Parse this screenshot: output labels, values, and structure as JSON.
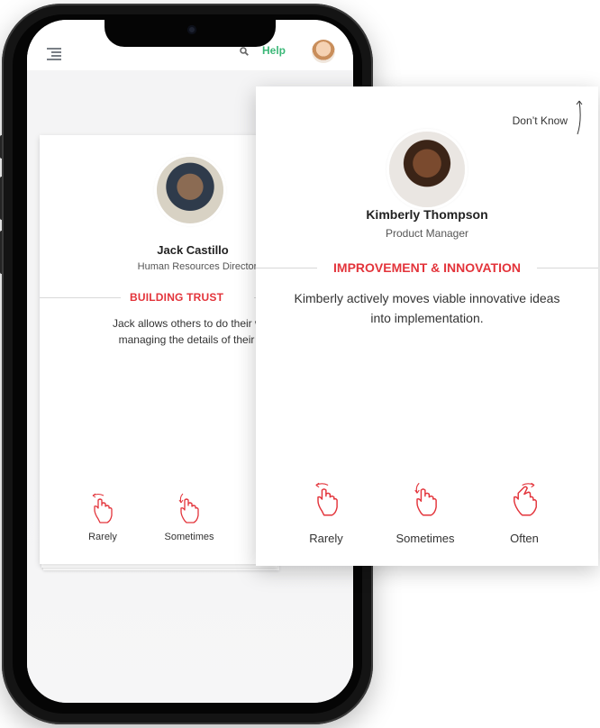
{
  "header": {
    "help_label": "Help",
    "icons": {
      "menu": "menu-icon",
      "search": "search-icon",
      "avatar": "user-avatar"
    }
  },
  "back_card": {
    "name": "Jack Castillo",
    "title": "Human Resources Director",
    "category": "BUILDING TRUST",
    "statement": "Jack allows others to do their without managing the details of their work.",
    "options": [
      {
        "label": "Rarely",
        "icon": "hand-swipe-left-icon"
      },
      {
        "label": "Sometimes",
        "icon": "hand-swipe-down-icon"
      }
    ]
  },
  "front_card": {
    "dont_know_label": "Don’t Know",
    "name": "Kimberly Thompson",
    "title": "Product Manager",
    "category": "IMPROVEMENT & INNOVATION",
    "statement": "Kimberly actively moves viable innovative ideas into implementation.",
    "options": [
      {
        "label": "Rarely",
        "icon": "hand-swipe-left-icon"
      },
      {
        "label": "Sometimes",
        "icon": "hand-swipe-down-icon"
      },
      {
        "label": "Often",
        "icon": "hand-swipe-right-icon"
      }
    ]
  },
  "colors": {
    "accent_red": "#e3343b",
    "help_green": "#3cb878"
  }
}
